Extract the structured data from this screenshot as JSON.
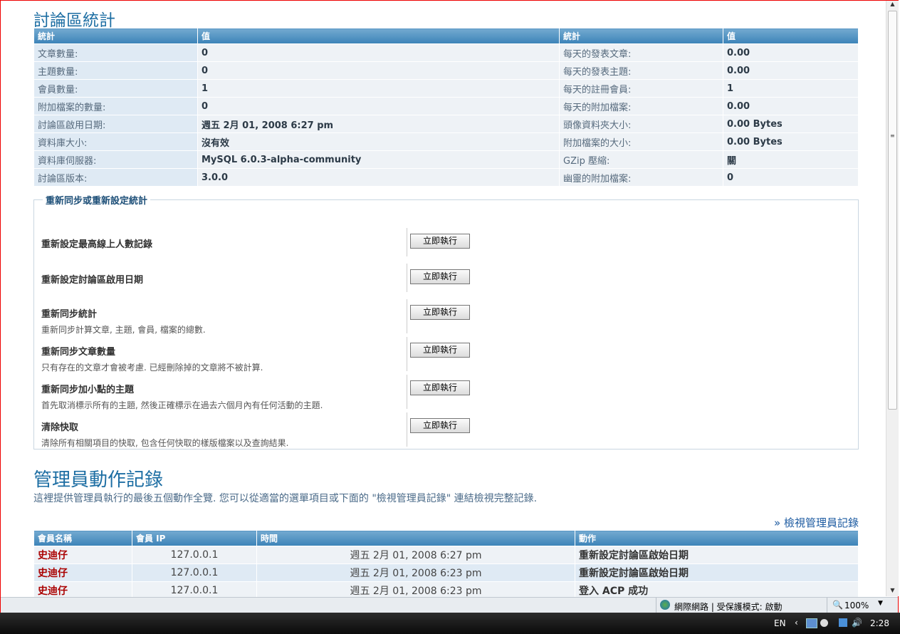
{
  "stats_section": {
    "title": "討論區統計",
    "headers": [
      "統計",
      "值",
      "統計",
      "值"
    ],
    "rows": [
      [
        "文章數量:",
        "0",
        "每天的發表文章:",
        "0.00"
      ],
      [
        "主題數量:",
        "0",
        "每天的發表主題:",
        "0.00"
      ],
      [
        "會員數量:",
        "1",
        "每天的註冊會員:",
        "1"
      ],
      [
        "附加檔案的數量:",
        "0",
        "每天的附加檔案:",
        "0.00"
      ],
      [
        "討論區啟用日期:",
        "週五 2月 01, 2008 6:27 pm",
        "頭像資料夾大小:",
        "0.00 Bytes"
      ],
      [
        "資料庫大小:",
        "沒有效",
        "附加檔案的大小:",
        "0.00 Bytes"
      ],
      [
        "資料庫伺服器:",
        "MySQL 6.0.3-alpha-community",
        "GZip 壓縮:",
        "關"
      ],
      [
        "討論區版本:",
        "3.0.0",
        "幽靈的附加檔案:",
        "0"
      ]
    ]
  },
  "resync": {
    "legend": "重新同步或重新設定統計",
    "button_label": "立即執行",
    "items": [
      {
        "title": "重新設定最高線上人數記錄",
        "desc": ""
      },
      {
        "title": "重新設定討論區啟用日期",
        "desc": ""
      },
      {
        "title": "重新同步統計",
        "desc": "重新同步計算文章, 主題, 會員, 檔案的總數."
      },
      {
        "title": "重新同步文章數量",
        "desc": "只有存在的文章才會被考慮. 已經刪除掉的文章將不被計算."
      },
      {
        "title": "重新同步加小點的主題",
        "desc": "首先取消標示所有的主題, 然後正確標示在過去六個月內有任何活動的主題."
      },
      {
        "title": "清除快取",
        "desc": "清除所有相關項目的快取, 包含任何快取的樣版檔案以及查詢結果."
      }
    ]
  },
  "admin_log": {
    "title": "管理員動作記錄",
    "intro": "這裡提供管理員執行的最後五個動作全覽. 您可以從適當的選單項目或下面的 \"檢視管理員記錄\" 連結檢視完整記錄.",
    "view_link": "» 檢視管理員記錄",
    "headers": [
      "會員名稱",
      "會員 IP",
      "時間",
      "動作"
    ],
    "rows": [
      [
        "史迪仔",
        "127.0.0.1",
        "週五 2月 01, 2008 6:27 pm",
        "重新設定討論區啟始日期"
      ],
      [
        "史迪仔",
        "127.0.0.1",
        "週五 2月 01, 2008 6:23 pm",
        "重新設定討論區啟始日期"
      ],
      [
        "史迪仔",
        "127.0.0.1",
        "週五 2月 01, 2008 6:23 pm",
        "登入 ACP 成功"
      ]
    ]
  },
  "statusbar": {
    "zone": "網際網路 | 受保護模式: 啟動",
    "zoom": "100%"
  },
  "taskbar": {
    "lang": "EN",
    "clock": "2:28"
  }
}
